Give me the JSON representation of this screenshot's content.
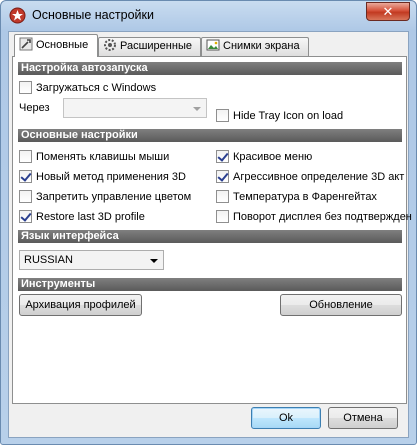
{
  "window": {
    "title": "Основные настройки",
    "close_label": "✕"
  },
  "tabs": [
    {
      "label": "Основные",
      "icon": "wrench-icon"
    },
    {
      "label": "Расширенные",
      "icon": "gear-icon"
    },
    {
      "label": "Снимки экрана",
      "icon": "screenshot-icon"
    }
  ],
  "sections": {
    "autostart": "Настройка автозапуска",
    "main": "Основные настройки",
    "language": "Язык интерфейса",
    "tools": "Инструменты"
  },
  "autostart": {
    "load_with_windows": {
      "label": "Загружаться с Windows",
      "checked": false
    },
    "delay_label": "Через",
    "delay_value": "",
    "hide_tray": {
      "label": "Hide Tray Icon on load",
      "checked": false
    }
  },
  "options_left": [
    {
      "label": "Поменять клавишы мыши",
      "checked": false
    },
    {
      "label": "Новый метод применения 3D",
      "checked": true
    },
    {
      "label": "Запретить управление цветом",
      "checked": false
    },
    {
      "label": "Restore last 3D profile",
      "checked": true
    }
  ],
  "options_right": [
    {
      "label": "Красивое меню",
      "checked": true
    },
    {
      "label": "Агрессивное определение 3D акт",
      "checked": true
    },
    {
      "label": "Температура в Фаренгейтах",
      "checked": false
    },
    {
      "label": "Поворот дисплея без подтвержден",
      "checked": false
    }
  ],
  "language": {
    "selected": "RUSSIAN"
  },
  "tools": {
    "archive_label": "Архивация профилей",
    "update_label": "Обновление"
  },
  "footer": {
    "ok_label": "Ok",
    "cancel_label": "Отмена"
  }
}
